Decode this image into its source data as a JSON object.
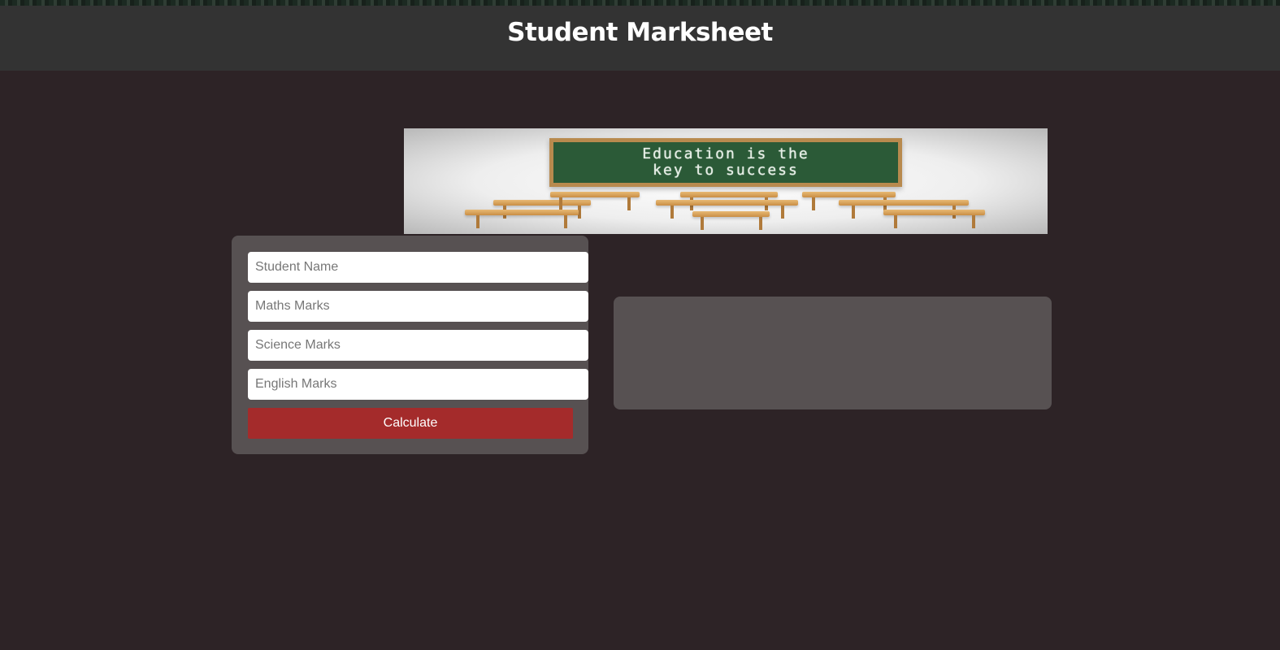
{
  "header": {
    "title": "Student Marksheet"
  },
  "banner": {
    "line1": "Education is the",
    "line2": "key to success"
  },
  "form": {
    "student_name_placeholder": "Student Name",
    "maths_placeholder": "Maths Marks",
    "science_placeholder": "Science Marks",
    "english_placeholder": "English Marks",
    "calculate_label": "Calculate"
  },
  "colors": {
    "background": "#2d2326",
    "header": "#333333",
    "card": "#575152",
    "button": "#a42b2b"
  }
}
